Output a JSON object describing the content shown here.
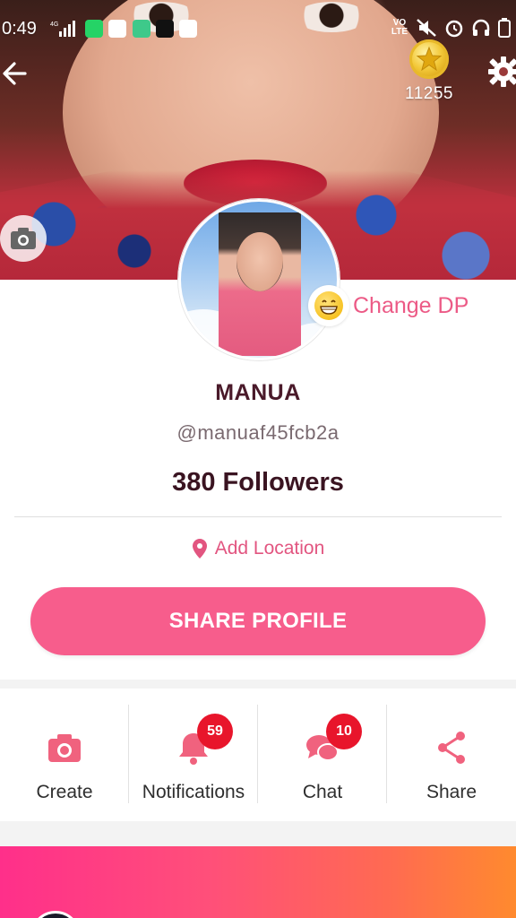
{
  "status_bar": {
    "time": "0:49",
    "network_label": "4G",
    "volte_label": "VO LTE",
    "app_icons": [
      "whatsapp-icon",
      "phone-icon",
      "shop-icon",
      "tiktok-icon",
      "messenger-icon"
    ]
  },
  "header": {
    "coin_balance": "11255"
  },
  "profile": {
    "change_dp_label": "Change DP",
    "name": "MANUA",
    "handle": "@manuaf45fcb2a",
    "followers": "380 Followers",
    "add_location": "Add Location",
    "share_profile": "SHARE PROFILE"
  },
  "actions": [
    {
      "label": "Create",
      "icon": "camera-icon",
      "badge": ""
    },
    {
      "label": "Notifications",
      "icon": "bell-icon",
      "badge": "59"
    },
    {
      "label": "Chat",
      "icon": "chat-icon",
      "badge": "10"
    },
    {
      "label": "Share",
      "icon": "share-icon",
      "badge": ""
    }
  ],
  "colors": {
    "accent": "#f75d8c",
    "accent_text": "#e25580",
    "badge": "#e8152b",
    "name_text": "#4a1a2a"
  }
}
